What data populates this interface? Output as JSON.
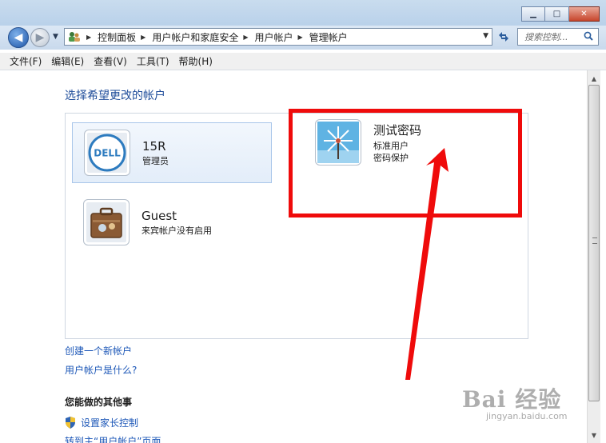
{
  "window": {
    "minimize_glyph": "▁",
    "maximize_glyph": "□",
    "close_glyph": "✕"
  },
  "nav": {
    "back_glyph": "◀",
    "forward_glyph": "▶",
    "dropdown_glyph": "▼"
  },
  "address": {
    "icon": "control-panel-users-icon",
    "crumbs": [
      "控制面板",
      "用户帐户和家庭安全",
      "用户帐户",
      "管理帐户"
    ],
    "separator_glyph": "▶",
    "dropdown_glyph": "▼"
  },
  "search": {
    "placeholder": "搜索控制..."
  },
  "menu": {
    "items": [
      "文件(F)",
      "编辑(E)",
      "查看(V)",
      "工具(T)",
      "帮助(H)"
    ]
  },
  "page": {
    "heading": "选择希望更改的帐户",
    "accounts": [
      {
        "name": "15R",
        "lines": [
          "管理员"
        ],
        "avatar": "dell-logo-avatar",
        "selected": true
      },
      {
        "name": "测试密码",
        "lines": [
          "标准用户",
          "密码保护"
        ],
        "avatar": "windmill-avatar",
        "selected": false
      },
      {
        "name": "Guest",
        "lines": [
          "来宾帐户没有启用"
        ],
        "avatar": "suitcase-avatar",
        "selected": false
      }
    ],
    "links": {
      "create_account": "创建一个新帐户",
      "what_is_account": "用户帐户是什么?"
    },
    "other_heading": "您能做的其他事",
    "tasks": [
      "设置家长控制",
      "转到主“用户帐户”页面"
    ]
  },
  "annotation": {
    "box_color": "#ef0b0b",
    "arrow_color": "#ef0b0b"
  },
  "watermark": {
    "brand": "Bai 经验",
    "site": "jingyan.baidu.com"
  }
}
